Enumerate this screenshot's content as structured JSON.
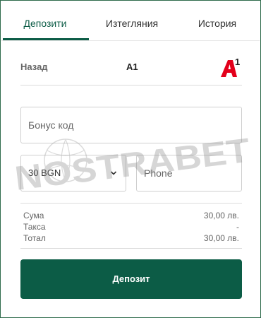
{
  "tabs": [
    {
      "label": "Депозити",
      "active": true
    },
    {
      "label": "Изтегляния",
      "active": false
    },
    {
      "label": "История",
      "active": false
    }
  ],
  "header": {
    "back_label": "Назад",
    "title": "A1",
    "logo_icon": "a1-logo-icon"
  },
  "form": {
    "bonus_placeholder": "Бонус код",
    "amount_value": "30 BGN",
    "phone_placeholder": "Phone"
  },
  "summary": {
    "rows": [
      {
        "label": "Сума",
        "value": "30,00 лв."
      },
      {
        "label": "Такса",
        "value": "-"
      },
      {
        "label": "Тотал",
        "value": "30,00 лв."
      }
    ]
  },
  "actions": {
    "deposit_label": "Депозит"
  },
  "watermark": {
    "text": "NOSTRABET"
  },
  "colors": {
    "brand_green": "#0c5c46",
    "a1_red": "#e3001b"
  }
}
